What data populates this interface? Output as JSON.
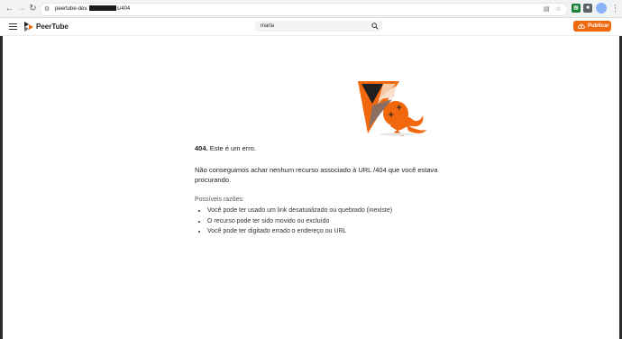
{
  "browser": {
    "url_prefix": "peertube-dev.",
    "url_suffix": "s/404"
  },
  "header": {
    "logo_text": "PeerTube",
    "search_value": "maria",
    "publish_label": "Publicar"
  },
  "error": {
    "code": "404.",
    "title_rest": " Este é um erro.",
    "description": "Não conseguimos achar nenhum recurso associado à URL /404 que você estava procurando.",
    "reasons_label": "Possíveis razões:",
    "reasons": [
      "Você pode ter usado um link desatualizado ou quebrado (inexiste)",
      "O recurso pode ter sido movido ou excluído",
      "Você pode ter digitado errado o endereço ou URL"
    ]
  },
  "colors": {
    "brand_orange": "#f1680d",
    "text_dark": "#222222"
  },
  "icons": [
    "back-arrow-icon",
    "forward-arrow-icon",
    "reload-icon",
    "site-info-icon",
    "cast-icon",
    "bookmark-star-icon",
    "extension-icon",
    "puzzle-icon",
    "profile-avatar",
    "menu-kebab-icon",
    "hamburger-menu-icon",
    "peertube-logo",
    "search-icon",
    "upload-cloud-icon",
    "mascot-illustration"
  ]
}
